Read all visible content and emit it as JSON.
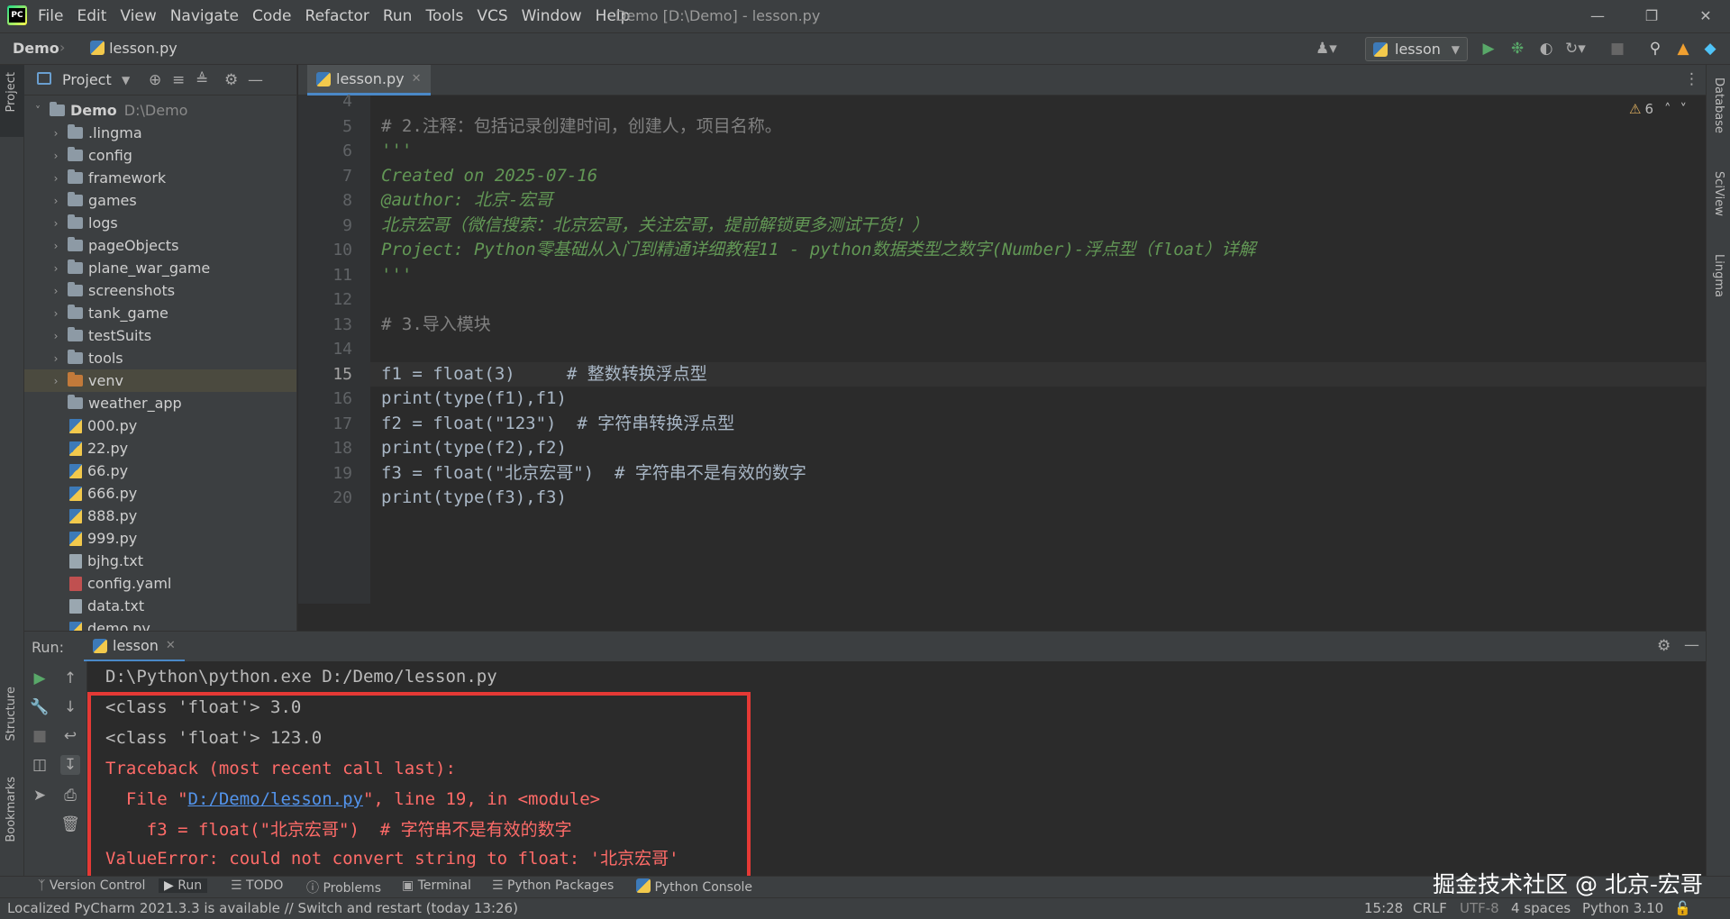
{
  "menubar": {
    "items": [
      "File",
      "Edit",
      "View",
      "Navigate",
      "Code",
      "Refactor",
      "Run",
      "Tools",
      "VCS",
      "Window",
      "Help"
    ],
    "window_title": "Demo [D:\\Demo] - lesson.py"
  },
  "navbar": {
    "project": "Demo",
    "file": "lesson.py",
    "run_config": "lesson"
  },
  "left_strip": {
    "project": "Project",
    "structure": "Structure",
    "bookmarks": "Bookmarks"
  },
  "right_strip": {
    "database": "Database",
    "sciview": "SciView",
    "lingma": "Lingma"
  },
  "project_panel": {
    "title": "Project",
    "root": {
      "name": "Demo",
      "path": "D:\\Demo"
    },
    "folders": [
      ".lingma",
      "config",
      "framework",
      "games",
      "logs",
      "pageObjects",
      "plane_war_game",
      "screenshots",
      "tank_game",
      "testSuits",
      "tools",
      "venv",
      "weather_app"
    ],
    "files": [
      "000.py",
      "22.py",
      "66.py",
      "666.py",
      "888.py",
      "999.py",
      "bjhg.txt",
      "config.yaml",
      "data.txt",
      "demo.py"
    ]
  },
  "editor": {
    "tab": "lesson.py",
    "warnings": "6",
    "line_numbers": [
      "4",
      "5",
      "6",
      "7",
      "8",
      "9",
      "10",
      "11",
      "12",
      "13",
      "14",
      "15",
      "16",
      "17",
      "18",
      "19",
      "20"
    ],
    "current_line": "15",
    "lines": [
      "",
      "# 2.注释：包括记录创建时间，创建人，项目名称。",
      "'''",
      "Created on 2025-07-16",
      "@author: 北京-宏哥",
      "北京宏哥（微信搜索：北京宏哥，关注宏哥，提前解锁更多测试干货！）",
      "Project: Python零基础从入门到精通详细教程11 - python数据类型之数字(Number)-浮点型（float）详解",
      "'''",
      "",
      "# 3.导入模块",
      "",
      "f1 = float(3)     # 整数转换浮点型",
      "print(type(f1),f1)",
      "f2 = float(\"123\")  # 字符串转换浮点型",
      "print(type(f2),f2)",
      "f3 = float(\"北京宏哥\")  # 字符串不是有效的数字",
      "print(type(f3),f3)"
    ]
  },
  "run_panel": {
    "label": "Run:",
    "tab": "lesson",
    "console": {
      "cmd": "D:\\Python\\python.exe D:/Demo/lesson.py",
      "out1": "<class 'float'> 3.0",
      "out2": "<class 'float'> 123.0",
      "tb": "Traceback (most recent call last):",
      "file_pre": "  File \"",
      "file_link": "D:/Demo/lesson.py",
      "file_post": "\", line 19, in <module>",
      "code": "    f3 = float(\"北京宏哥\")  # 字符串不是有效的数字",
      "error": "ValueError: could not convert string to float: '北京宏哥'"
    }
  },
  "tool_tabs": [
    "Version Control",
    "Run",
    "TODO",
    "Problems",
    "Terminal",
    "Python Packages",
    "Python Console"
  ],
  "status": {
    "message": "Localized PyCharm 2021.3.3 is available // Switch and restart (today 13:26)",
    "position": "15:28",
    "line_sep": "CRLF",
    "encoding": "UTF-8",
    "indent": "4 spaces",
    "interpreter": "Python 3.10"
  },
  "watermark": "掘金技术社区 @ 北京-宏哥"
}
